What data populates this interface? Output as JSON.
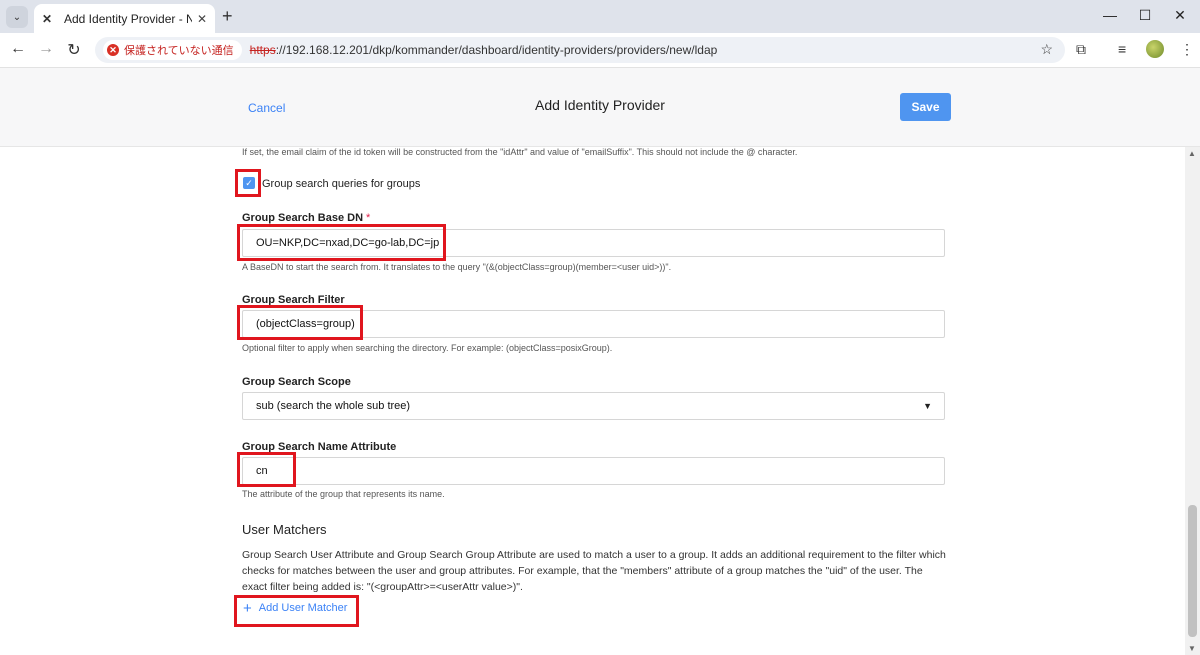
{
  "browser": {
    "tab_title": "Add Identity Provider - Nutanix",
    "tab_favicon": "✕",
    "new_tab_symbol": "+",
    "security_label": "保護されていない通信",
    "url_scheme": "https",
    "url_rest": "://192.168.12.201/dkp/kommander/dashboard/identity-providers/providers/new/ldap",
    "icons": [
      "tab-search-icon",
      "close-tab-icon",
      "minimize-icon",
      "maximize-icon",
      "window-close-icon",
      "back-icon",
      "forward-icon",
      "reload-icon",
      "not-secure-icon",
      "bookmark-star-icon",
      "extensions-icon",
      "media-icon",
      "profile-avatar-icon",
      "menu-icon"
    ]
  },
  "header": {
    "cancel_label": "Cancel",
    "title": "Add Identity Provider",
    "save_label": "Save"
  },
  "form": {
    "email_suffix_help": "If set, the email claim of the id token will be constructed from the \"idAttr\" and value of \"emailSuffix\". This should not include the @ character.",
    "group_search_checkbox": {
      "label": "Group search queries for groups",
      "checked": true
    },
    "base_dn": {
      "label": "Group Search Base DN",
      "required_mark": "*",
      "value": "OU=NKP,DC=nxad,DC=go-lab,DC=jp",
      "help": "A BaseDN to start the search from. It translates to the query \"(&(objectClass=group)(member=<user uid>))\"."
    },
    "filter": {
      "label": "Group Search Filter",
      "value": "(objectClass=group)",
      "help": "Optional filter to apply when searching the directory. For example: (objectClass=posixGroup)."
    },
    "scope": {
      "label": "Group Search Scope",
      "selected": "sub (search the whole sub tree)"
    },
    "name_attr": {
      "label": "Group Search Name Attribute",
      "value": "cn",
      "help": "The attribute of the group that represents its name."
    },
    "user_matchers": {
      "title": "User Matchers",
      "description": "Group Search User Attribute and Group Search Group Attribute are used to match a user to a group. It adds an additional requirement to the filter which checks for matches between the user and group attributes. For example, that the \"members\" attribute of a group matches the \"uid\" of the user. The exact filter being added is: \"(<groupAttr>=<userAttr value>)\".",
      "add_label": "Add User Matcher",
      "add_symbol": "+"
    }
  },
  "colors": {
    "accent": "#4f95f0",
    "link": "#3b82f6",
    "annotation": "#e0161e",
    "required": "#e11d48"
  }
}
